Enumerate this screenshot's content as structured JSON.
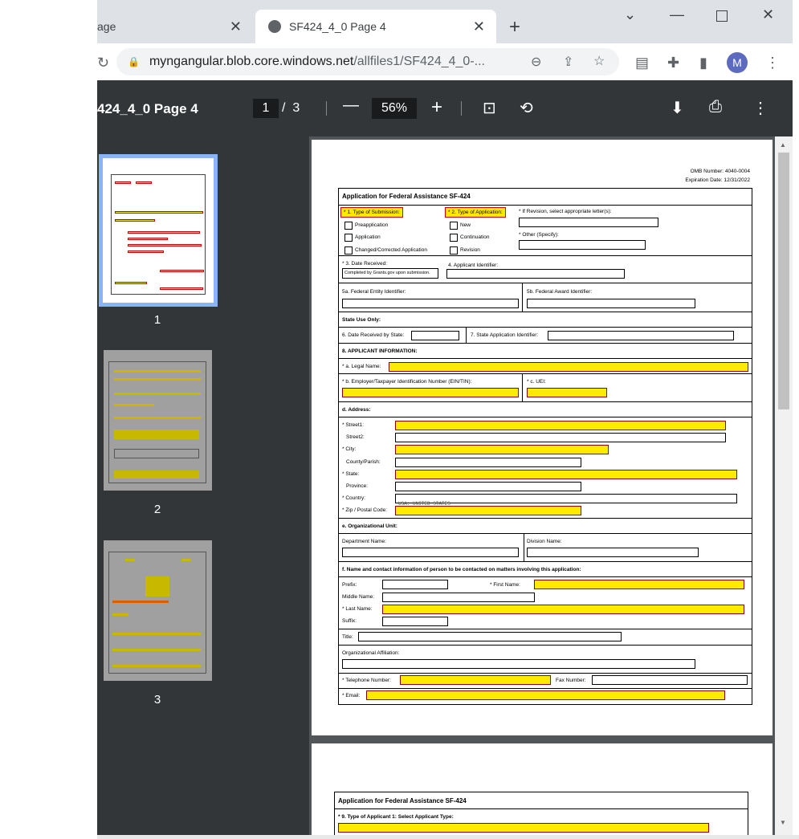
{
  "browser": {
    "tabs": [
      {
        "title": "age",
        "active": false
      },
      {
        "title": "SF424_4_0 Page 4",
        "active": true
      }
    ],
    "url_host": "myngangular.blob.core.windows.net",
    "url_path": "/allfiles1/SF424_4_0-...",
    "avatar_letter": "M"
  },
  "pdf_toolbar": {
    "title": "424_4_0 Page 4",
    "current_page": "1",
    "page_separator": "/",
    "total_pages": "3",
    "zoom": "56%"
  },
  "thumbnails": [
    {
      "number": "1",
      "selected": true
    },
    {
      "number": "2",
      "selected": false
    },
    {
      "number": "3",
      "selected": false
    }
  ],
  "form": {
    "omb_number": "OMB Number: 4040-0004",
    "expiration": "Expiration Date: 12/31/2022",
    "title": "Application for Federal Assistance SF-424",
    "type_of_submission": "* 1. Type of Submission:",
    "submission_options": [
      "Preapplication",
      "Application",
      "Changed/Corrected Application"
    ],
    "type_of_application": "* 2. Type of Application:",
    "application_options": [
      "New",
      "Continuation",
      "Revision"
    ],
    "revision_label": "* If Revision, select appropriate letter(s):",
    "other_specify": "* Other (Specify):",
    "date_received": "* 3. Date Received:",
    "date_received_value": "Completed by Grants.gov upon submission.",
    "applicant_identifier": "4. Applicant Identifier:",
    "federal_entity_id": "5a. Federal Entity Identifier:",
    "federal_award_id": "5b. Federal Award Identifier:",
    "state_use_only": "State Use Only:",
    "date_received_state": "6. Date Received by State:",
    "state_app_id": "7. State Application Identifier:",
    "applicant_info": "8. APPLICANT INFORMATION:",
    "legal_name": "* a. Legal Name:",
    "ein": "* b. Employer/Taxpayer Identification Number (EIN/TIN):",
    "uei": "* c. UEI:",
    "address": "d. Address:",
    "street1": "* Street1:",
    "street2": "Street2:",
    "city": "* City:",
    "county": "County/Parish:",
    "state": "* State:",
    "province": "Province:",
    "country": "* Country:",
    "country_value": "USA: UNITED STATES",
    "zip": "* Zip / Postal Code:",
    "org_unit": "e. Organizational Unit:",
    "department": "Department Name:",
    "division": "Division Name:",
    "contact_section": "f. Name and contact information of person to be contacted on matters involving this application:",
    "prefix": "Prefix:",
    "first_name": "* First Name:",
    "middle_name": "Middle Name:",
    "last_name": "* Last Name:",
    "suffix": "Suffix:",
    "title_field": "Title:",
    "org_affiliation": "Organizational Affiliation:",
    "telephone": "* Telephone Number:",
    "fax": "Fax Number:",
    "email": "* Email:"
  },
  "page2": {
    "title": "Application for Federal Assistance SF-424",
    "applicant_type": "* 9. Type of Applicant 1: Select Applicant Type:"
  },
  "colors": {
    "required_fill": "#ffea00",
    "required_border": "#8b0000",
    "pdf_bg": "#525659",
    "sidebar_bg": "#323639",
    "thumb_selected": "#8ab4f8"
  }
}
